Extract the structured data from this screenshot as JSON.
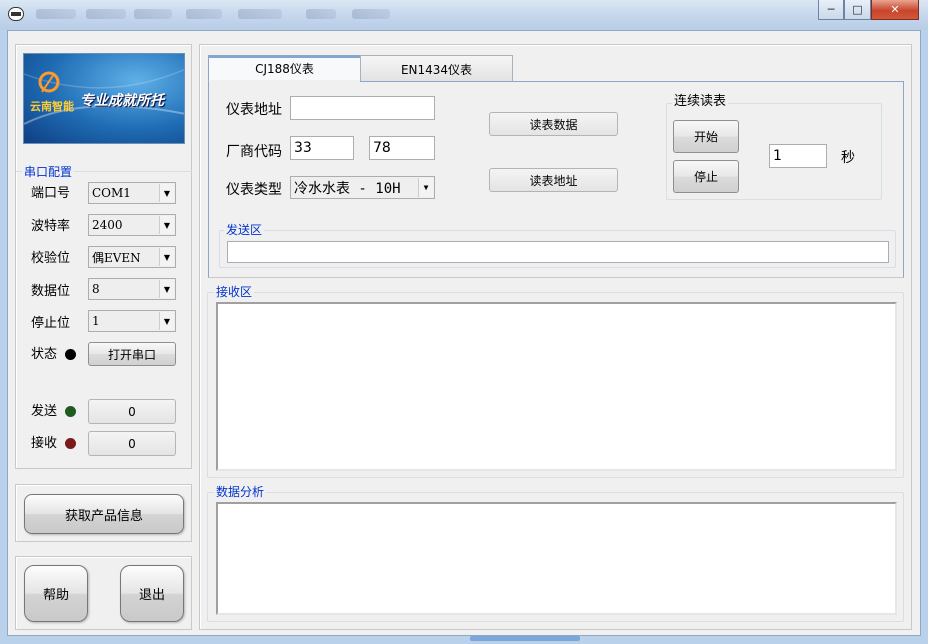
{
  "window": {
    "controls": {
      "minimize": "─",
      "maximize": "□",
      "close": "✕"
    }
  },
  "left": {
    "logo": {
      "brand": "云南智能",
      "slogan": "专业成就所托"
    },
    "serial_group_label": "串口配置",
    "port_label": "端口号",
    "port_value": "COM1",
    "baud_label": "波特率",
    "baud_value": "2400",
    "parity_label": "校验位",
    "parity_value": "偶EVEN",
    "databits_label": "数据位",
    "databits_value": "8",
    "stopbits_label": "停止位",
    "stopbits_value": "1",
    "status_label": "状态",
    "open_port_label": "打开串口",
    "send_label": "发送",
    "send_count": "0",
    "recv_label": "接收",
    "recv_count": "0",
    "product_info_label": "获取产品信息",
    "help_label": "帮助",
    "exit_label": "退出"
  },
  "tabs": [
    "CJ188仪表",
    "EN1434仪表"
  ],
  "form": {
    "address_label": "仪表地址",
    "address_value": "",
    "vendor_label": "厂商代码",
    "vendor_code1": "33",
    "vendor_code2": "78",
    "type_label": "仪表类型",
    "type_value": "冷水水表 - 10H",
    "read_data_label": "读表数据",
    "read_addr_label": "读表地址",
    "continuous_label": "连续读表",
    "start_label": "开始",
    "stop_label": "停止",
    "interval_value": "1",
    "seconds_label": "秒"
  },
  "send_area_label": "发送区",
  "recv_area_label": "接收区",
  "analysis_area_label": "数据分析",
  "colors": {
    "led_status": "#000000",
    "led_send": "#1e5c1e",
    "led_recv": "#7a1a1a",
    "group_label": "#0033cc"
  }
}
